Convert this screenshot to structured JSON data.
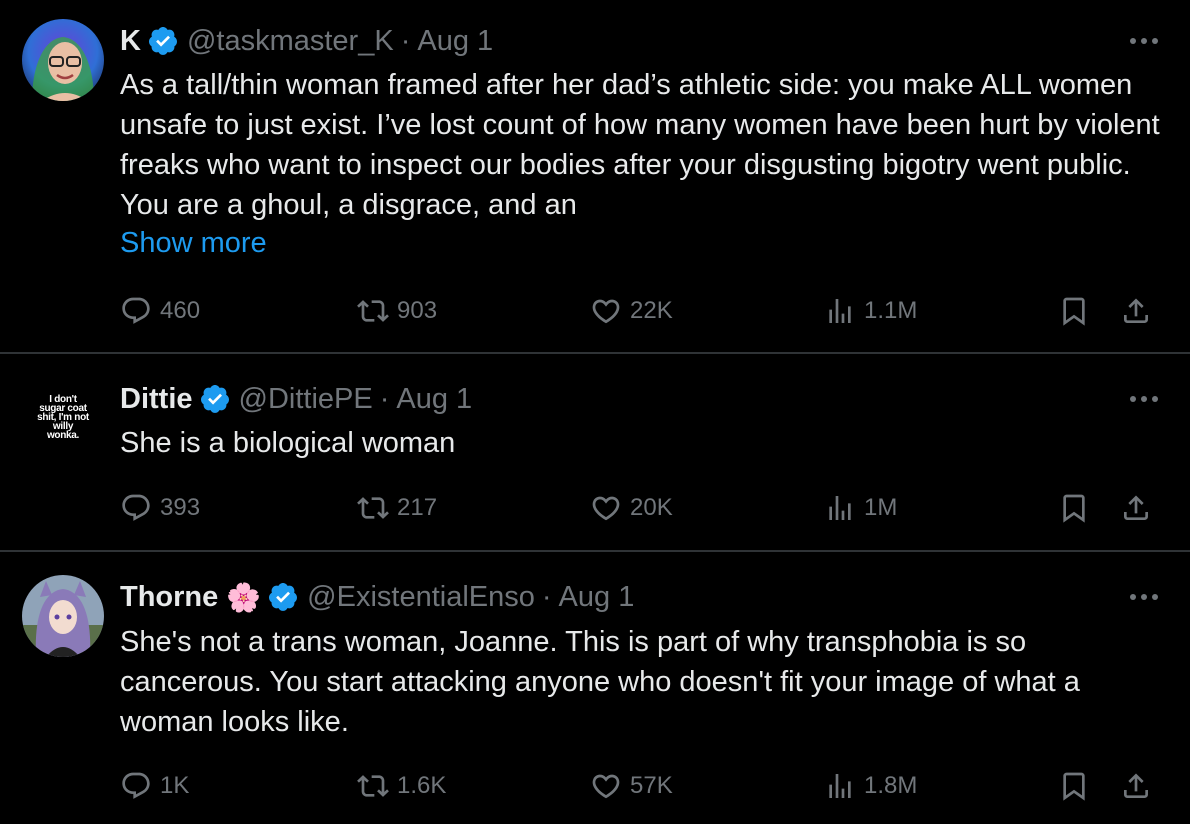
{
  "tweets": [
    {
      "name": "K",
      "handle": "@taskmaster_K",
      "separator": "·",
      "date": "Aug 1",
      "text": "As a tall/thin woman framed after her dad’s athletic side: you make ALL women unsafe to just exist. I’ve lost count of how many women have been hurt by violent freaks who want to inspect our bodies after your disgusting bigotry went public. You are a ghoul, a disgrace, and an",
      "show_more": "Show more",
      "replies": "460",
      "reposts": "903",
      "likes": "22K",
      "views": "1.1M"
    },
    {
      "name": "Dittie",
      "handle": "@DittiePE",
      "separator": "·",
      "date": "Aug 1",
      "avatar_text": "I don't sugar coat shit, I'm not willy wonka.",
      "text": "She is a biological woman",
      "replies": "393",
      "reposts": "217",
      "likes": "20K",
      "views": "1M"
    },
    {
      "name": "Thorne",
      "name_emoji": "🌸",
      "handle": "@ExistentialEnso",
      "separator": "·",
      "date": "Aug 1",
      "text": "She's not a trans woman, Joanne. This is part of why transphobia is so cancerous. You start attacking anyone who doesn't fit your image of what a woman looks like.",
      "replies": "1K",
      "reposts": "1.6K",
      "likes": "57K",
      "views": "1.8M"
    }
  ],
  "colors": {
    "background": "#000000",
    "text": "#e7e9ea",
    "secondary": "#71767b",
    "accent": "#1d9bf0",
    "divider": "#2f3336"
  },
  "icons": [
    "verified-badge-icon",
    "more-icon",
    "reply-icon",
    "repost-icon",
    "like-icon",
    "views-icon",
    "bookmark-icon",
    "share-icon"
  ]
}
